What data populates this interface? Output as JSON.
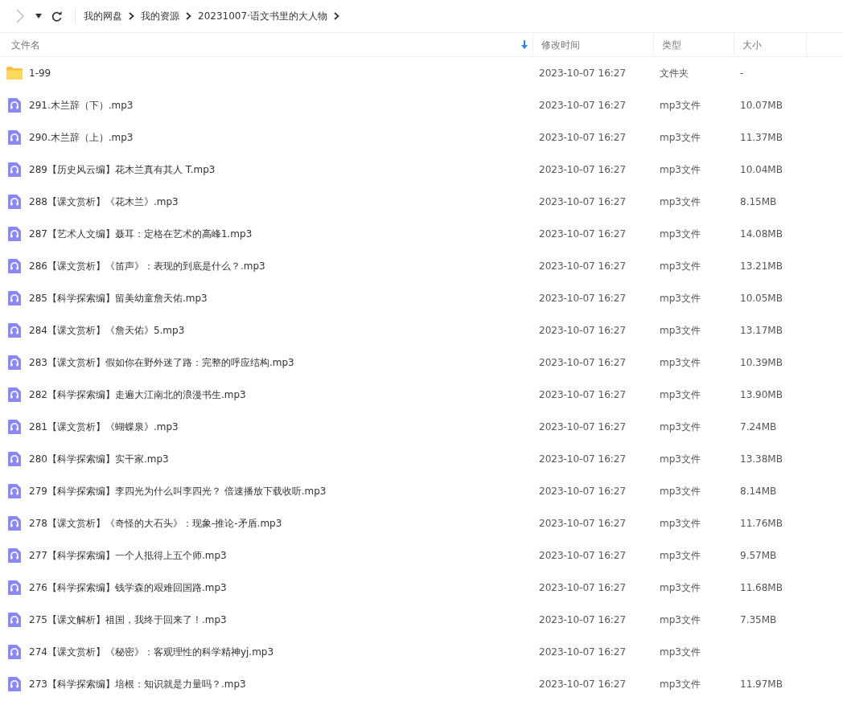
{
  "toolbar": {
    "breadcrumbs": [
      "我的网盘",
      "我的资源",
      "20231007·语文书里的大人物"
    ]
  },
  "table": {
    "columns": [
      {
        "label": "文件名",
        "sorted": true
      },
      {
        "label": "修改时间",
        "sorted": false
      },
      {
        "label": "类型",
        "sorted": false
      },
      {
        "label": "大小",
        "sorted": false
      }
    ],
    "rows": [
      {
        "kind": "folder",
        "name": "1-99",
        "modified": "2023-10-07 16:27",
        "type": "文件夹",
        "size": "-"
      },
      {
        "kind": "audio",
        "name": "291.木兰辞（下）.mp3",
        "modified": "2023-10-07 16:27",
        "type": "mp3文件",
        "size": "10.07MB"
      },
      {
        "kind": "audio",
        "name": "290.木兰辞（上）.mp3",
        "modified": "2023-10-07 16:27",
        "type": "mp3文件",
        "size": "11.37MB"
      },
      {
        "kind": "audio",
        "name": "289【历史风云编】花木兰真有其人 T.mp3",
        "modified": "2023-10-07 16:27",
        "type": "mp3文件",
        "size": "10.04MB"
      },
      {
        "kind": "audio",
        "name": "288【课文赏析】《花木兰》.mp3",
        "modified": "2023-10-07 16:27",
        "type": "mp3文件",
        "size": "8.15MB"
      },
      {
        "kind": "audio",
        "name": "287【艺术人文编】聂耳：定格在艺术的高峰1.mp3",
        "modified": "2023-10-07 16:27",
        "type": "mp3文件",
        "size": "14.08MB"
      },
      {
        "kind": "audio",
        "name": "286【课文赏析】《笛声》：表现的到底是什么？.mp3",
        "modified": "2023-10-07 16:27",
        "type": "mp3文件",
        "size": "13.21MB"
      },
      {
        "kind": "audio",
        "name": "285【科学探索编】留美幼童詹天佑.mp3",
        "modified": "2023-10-07 16:27",
        "type": "mp3文件",
        "size": "10.05MB"
      },
      {
        "kind": "audio",
        "name": "284【课文赏析】《詹天佑》5.mp3",
        "modified": "2023-10-07 16:27",
        "type": "mp3文件",
        "size": "13.17MB"
      },
      {
        "kind": "audio",
        "name": "283【课文赏析】假如你在野外迷了路：完整的呼应结构.mp3",
        "modified": "2023-10-07 16:27",
        "type": "mp3文件",
        "size": "10.39MB"
      },
      {
        "kind": "audio",
        "name": "282【科学探索编】走遍大江南北的浪漫书生.mp3",
        "modified": "2023-10-07 16:27",
        "type": "mp3文件",
        "size": "13.90MB"
      },
      {
        "kind": "audio",
        "name": "281【课文赏析】《蝴蝶泉》.mp3",
        "modified": "2023-10-07 16:27",
        "type": "mp3文件",
        "size": "7.24MB"
      },
      {
        "kind": "audio",
        "name": "280【科学探索编】实干家.mp3",
        "modified": "2023-10-07 16:27",
        "type": "mp3文件",
        "size": "13.38MB"
      },
      {
        "kind": "audio",
        "name": "279【科学探索编】李四光为什么叫李四光？ 倍速播放下载收听.mp3",
        "modified": "2023-10-07 16:27",
        "type": "mp3文件",
        "size": "8.14MB"
      },
      {
        "kind": "audio",
        "name": "278【课文赏析】《奇怪的大石头》：现象-推论-矛盾.mp3",
        "modified": "2023-10-07 16:27",
        "type": "mp3文件",
        "size": "11.76MB"
      },
      {
        "kind": "audio",
        "name": "277【科学探索编】一个人抵得上五个师.mp3",
        "modified": "2023-10-07 16:27",
        "type": "mp3文件",
        "size": "9.57MB"
      },
      {
        "kind": "audio",
        "name": "276【科学探索编】钱学森的艰难回国路.mp3",
        "modified": "2023-10-07 16:27",
        "type": "mp3文件",
        "size": "11.68MB"
      },
      {
        "kind": "audio",
        "name": "275【课文解析】祖国，我终于回来了！.mp3",
        "modified": "2023-10-07 16:27",
        "type": "mp3文件",
        "size": "7.35MB"
      },
      {
        "kind": "audio",
        "name": "274【课文赏析】《秘密》：客观理性的科学精神yj.mp3",
        "modified": "2023-10-07 16:27",
        "type": "mp3文件"
      },
      {
        "kind": "audio",
        "name": "273【科学探索编】培根：知识就是力量吗？.mp3",
        "modified": "2023-10-07 16:27",
        "type": "mp3文件",
        "size": "11.97MB"
      }
    ]
  }
}
